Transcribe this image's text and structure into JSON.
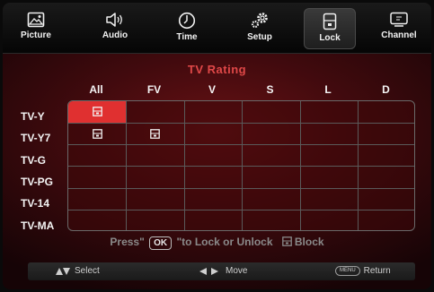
{
  "menu": {
    "items": [
      {
        "label": "Picture",
        "icon": "picture-icon"
      },
      {
        "label": "Audio",
        "icon": "speaker-icon"
      },
      {
        "label": "Time",
        "icon": "clock-icon"
      },
      {
        "label": "Setup",
        "icon": "gears-icon"
      },
      {
        "label": "Lock",
        "icon": "lock-icon",
        "active": true
      },
      {
        "label": "Channel",
        "icon": "tv-icon"
      }
    ]
  },
  "rating": {
    "title": "TV Rating",
    "columns": [
      "All",
      "FV",
      "V",
      "S",
      "L",
      "D"
    ],
    "rows": [
      "TV-Y",
      "TV-Y7",
      "TV-G",
      "TV-PG",
      "TV-14",
      "TV-MA"
    ],
    "locked": [
      [
        true,
        false,
        false,
        false,
        false,
        false
      ],
      [
        true,
        true,
        false,
        false,
        false,
        false
      ],
      [
        false,
        false,
        false,
        false,
        false,
        false
      ],
      [
        false,
        false,
        false,
        false,
        false,
        false
      ],
      [
        false,
        false,
        false,
        false,
        false,
        false
      ],
      [
        false,
        false,
        false,
        false,
        false,
        false
      ]
    ],
    "selected_cell": [
      0,
      0
    ]
  },
  "hint": {
    "press": "Press\"",
    "ok_key": "OK",
    "action": "\"to Lock or Unlock",
    "block_label": "Block"
  },
  "footer": {
    "select": "Select",
    "move": "Move",
    "menu_key": "MENU",
    "return": "Return"
  },
  "colors": {
    "accent": "#e04848",
    "selected": "#e03030"
  }
}
